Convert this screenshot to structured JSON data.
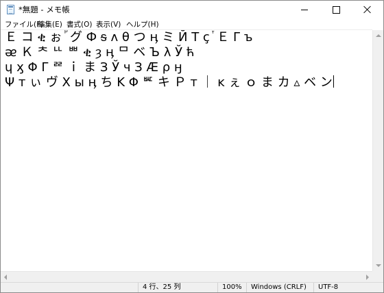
{
  "window": {
    "title": "*無題 - メモ帳",
    "icon": "notepad-icon"
  },
  "caption_buttons": {
    "minimize_icon": "minimize-icon",
    "maximize_icon": "maximize-icon",
    "close_icon": "close-icon"
  },
  "menu": {
    "items": [
      {
        "label": "ファイル(F)"
      },
      {
        "label": "編集(E)"
      },
      {
        "label": "書式(O)"
      },
      {
        "label": "表示(V)"
      },
      {
        "label": "ヘルプ(H)"
      }
    ]
  },
  "editor": {
    "lines": [
      "Ｅ コ ቂ ぉ ⷬ グ Ф ᵴ ᴧ θ つ ӊ ミ Й Т ҫ ⷮ Ｅ Γ ъ",
      "ᴂ Ｋ ᄎ ᄔ ᄈ ቂ ȝ ӊ ᄆ ベ Ъ λ Ў ћ",
      "ɥ ӽ Φ Γ ᄙ ｉ ま З Ў ч З Æ ρ ӈ",
      "Ψ т ぃ ヴ Χ ы ӊ ち Κ Φ ᄣ キ Ｐ т ｜ ĸ ぇ ｏ ま カ ▵ ベ ン"
    ],
    "cursor": {
      "line": 4,
      "column": 25
    }
  },
  "status": {
    "position": "4 行、25 列",
    "zoom": "100%",
    "line_ending": "Windows (CRLF)",
    "encoding": "UTF-8"
  }
}
